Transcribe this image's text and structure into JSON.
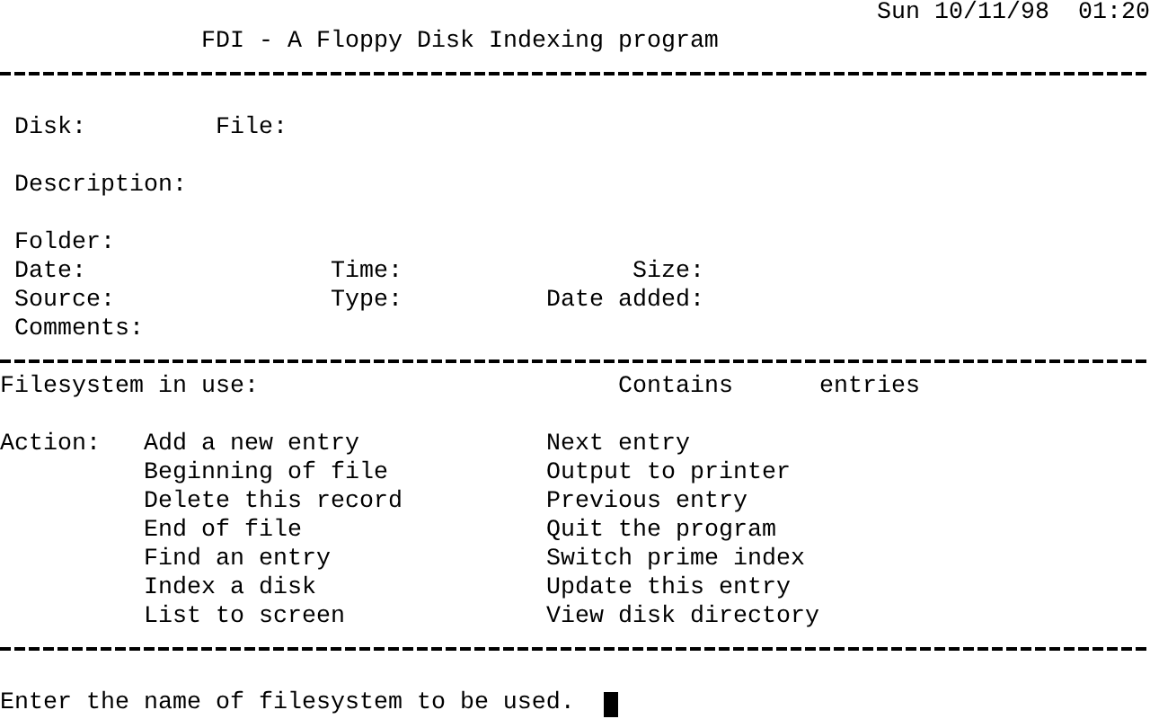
{
  "header": {
    "date_time": "Sun 10/11/98  01:20",
    "title": "FDI - A Floppy Disk Indexing program"
  },
  "record_fields": [
    {
      "label": "Disk:"
    },
    {
      "label": "File:"
    },
    {
      "label": "Description:"
    },
    {
      "label": "Folder:"
    },
    {
      "label": "Date:"
    },
    {
      "label": "Time:"
    },
    {
      "label": "Size:"
    },
    {
      "label": "Source:"
    },
    {
      "label": "Type:"
    },
    {
      "label": "Date added:"
    },
    {
      "label": "Comments:"
    }
  ],
  "status": {
    "filesystem_label": "Filesystem in use:",
    "contains_label": "Contains",
    "entries_label": "entries"
  },
  "actions": {
    "label": "Action:",
    "items": [
      "Add a new entry",
      "Beginning of file",
      "Delete this record",
      "End of file",
      "Find an entry",
      "Index a disk",
      "List to screen",
      "Next entry",
      "Output to printer",
      "Previous entry",
      "Quit the program",
      "Switch prime index",
      "Update this entry",
      "View disk directory"
    ]
  },
  "prompt": {
    "text": "Enter the name of filesystem to be used."
  }
}
